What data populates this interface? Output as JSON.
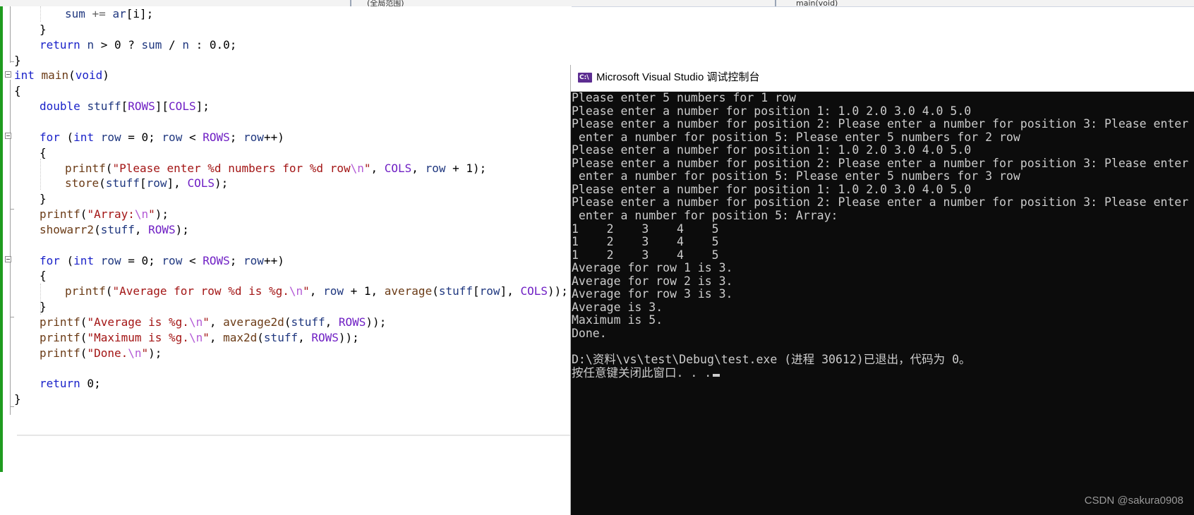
{
  "tabs": {
    "scope": "(全局范围)",
    "member": "main(void)"
  },
  "editor": {
    "lines": [
      {
        "parts": [
          [
            "id",
            "sum"
          ],
          [
            "op",
            " += "
          ],
          [
            "id",
            "ar"
          ],
          [
            "num",
            "[i];"
          ]
        ]
      },
      {
        "parts": [
          [
            "num",
            "}"
          ]
        ]
      },
      {
        "parts": [
          [
            "kw",
            "return"
          ],
          [
            "num",
            " "
          ],
          [
            "id",
            "n"
          ],
          [
            "num",
            " > 0 ? "
          ],
          [
            "id",
            "sum"
          ],
          [
            "num",
            " / "
          ],
          [
            "id",
            "n"
          ],
          [
            "num",
            " : 0.0;"
          ]
        ]
      },
      {
        "parts": [
          [
            "num",
            "}"
          ]
        ]
      },
      {
        "parts": [
          [
            "kw",
            "int"
          ],
          [
            "num",
            " "
          ],
          [
            "fn",
            "main"
          ],
          [
            "num",
            "("
          ],
          [
            "kw",
            "void"
          ],
          [
            "num",
            ")"
          ]
        ]
      },
      {
        "parts": [
          [
            "num",
            "{"
          ]
        ]
      },
      {
        "parts": [
          [
            "kw",
            "double"
          ],
          [
            "num",
            " "
          ],
          [
            "id",
            "stuff"
          ],
          [
            "num",
            "["
          ],
          [
            "mac",
            "ROWS"
          ],
          [
            "num",
            "]["
          ],
          [
            "mac",
            "COLS"
          ],
          [
            "num",
            "];"
          ]
        ]
      },
      {
        "parts": []
      },
      {
        "parts": [
          [
            "kw",
            "for"
          ],
          [
            "num",
            " ("
          ],
          [
            "kw",
            "int"
          ],
          [
            "num",
            " "
          ],
          [
            "id",
            "row"
          ],
          [
            "num",
            " = 0; "
          ],
          [
            "id",
            "row"
          ],
          [
            "num",
            " < "
          ],
          [
            "mac",
            "ROWS"
          ],
          [
            "num",
            "; "
          ],
          [
            "id",
            "row"
          ],
          [
            "num",
            "++)"
          ]
        ]
      },
      {
        "parts": [
          [
            "num",
            "{"
          ]
        ]
      },
      {
        "parts": [
          [
            "fn",
            "printf"
          ],
          [
            "num",
            "("
          ],
          [
            "str",
            "\"Please enter %d numbers for %d row"
          ],
          [
            "esc",
            "\\n"
          ],
          [
            "str",
            "\""
          ],
          [
            "num",
            ", "
          ],
          [
            "mac",
            "COLS"
          ],
          [
            "num",
            ", "
          ],
          [
            "id",
            "row"
          ],
          [
            "num",
            " + 1);"
          ]
        ]
      },
      {
        "parts": [
          [
            "fn",
            "store"
          ],
          [
            "num",
            "("
          ],
          [
            "id",
            "stuff"
          ],
          [
            "num",
            "["
          ],
          [
            "id",
            "row"
          ],
          [
            "num",
            "], "
          ],
          [
            "mac",
            "COLS"
          ],
          [
            "num",
            ");"
          ]
        ]
      },
      {
        "parts": [
          [
            "num",
            "}"
          ]
        ]
      },
      {
        "parts": [
          [
            "fn",
            "printf"
          ],
          [
            "num",
            "("
          ],
          [
            "str",
            "\"Array:"
          ],
          [
            "esc",
            "\\n"
          ],
          [
            "str",
            "\""
          ],
          [
            "num",
            ");"
          ]
        ]
      },
      {
        "parts": [
          [
            "fn",
            "showarr2"
          ],
          [
            "num",
            "("
          ],
          [
            "id",
            "stuff"
          ],
          [
            "num",
            ", "
          ],
          [
            "mac",
            "ROWS"
          ],
          [
            "num",
            ");"
          ]
        ]
      },
      {
        "parts": []
      },
      {
        "parts": [
          [
            "kw",
            "for"
          ],
          [
            "num",
            " ("
          ],
          [
            "kw",
            "int"
          ],
          [
            "num",
            " "
          ],
          [
            "id",
            "row"
          ],
          [
            "num",
            " = 0; "
          ],
          [
            "id",
            "row"
          ],
          [
            "num",
            " < "
          ],
          [
            "mac",
            "ROWS"
          ],
          [
            "num",
            "; "
          ],
          [
            "id",
            "row"
          ],
          [
            "num",
            "++)"
          ]
        ]
      },
      {
        "parts": [
          [
            "num",
            "{"
          ]
        ]
      },
      {
        "parts": [
          [
            "fn",
            "printf"
          ],
          [
            "num",
            "("
          ],
          [
            "str",
            "\"Average for row %d is %g."
          ],
          [
            "esc",
            "\\n"
          ],
          [
            "str",
            "\""
          ],
          [
            "num",
            ", "
          ],
          [
            "id",
            "row"
          ],
          [
            "num",
            " + 1, "
          ],
          [
            "fn",
            "average"
          ],
          [
            "num",
            "("
          ],
          [
            "id",
            "stuff"
          ],
          [
            "num",
            "["
          ],
          [
            "id",
            "row"
          ],
          [
            "num",
            "], "
          ],
          [
            "mac",
            "COLS"
          ],
          [
            "num",
            "));"
          ]
        ]
      },
      {
        "parts": [
          [
            "num",
            "}"
          ]
        ]
      },
      {
        "parts": [
          [
            "fn",
            "printf"
          ],
          [
            "num",
            "("
          ],
          [
            "str",
            "\"Average is %g."
          ],
          [
            "esc",
            "\\n"
          ],
          [
            "str",
            "\""
          ],
          [
            "num",
            ", "
          ],
          [
            "fn",
            "average2d"
          ],
          [
            "num",
            "("
          ],
          [
            "id",
            "stuff"
          ],
          [
            "num",
            ", "
          ],
          [
            "mac",
            "ROWS"
          ],
          [
            "num",
            "));"
          ]
        ]
      },
      {
        "parts": [
          [
            "fn",
            "printf"
          ],
          [
            "num",
            "("
          ],
          [
            "str",
            "\"Maximum is %g."
          ],
          [
            "esc",
            "\\n"
          ],
          [
            "str",
            "\""
          ],
          [
            "num",
            ", "
          ],
          [
            "fn",
            "max2d"
          ],
          [
            "num",
            "("
          ],
          [
            "id",
            "stuff"
          ],
          [
            "num",
            ", "
          ],
          [
            "mac",
            "ROWS"
          ],
          [
            "num",
            "));"
          ]
        ]
      },
      {
        "parts": [
          [
            "fn",
            "printf"
          ],
          [
            "num",
            "("
          ],
          [
            "str",
            "\"Done."
          ],
          [
            "esc",
            "\\n"
          ],
          [
            "str",
            "\""
          ],
          [
            "num",
            ");"
          ]
        ]
      },
      {
        "parts": []
      },
      {
        "parts": [
          [
            "kw",
            "return"
          ],
          [
            "num",
            " 0;"
          ]
        ]
      },
      {
        "parts": [
          [
            "num",
            "}"
          ]
        ]
      }
    ]
  },
  "console": {
    "title": "Microsoft Visual Studio 调试控制台",
    "icon": "vs-console-icon",
    "lines": [
      "Please enter 5 numbers for 1 row",
      "Please enter a number for position 1: 1.0 2.0 3.0 4.0 5.0",
      "Please enter a number for position 2: Please enter a number for position 3: Please enter",
      " enter a number for position 5: Please enter 5 numbers for 2 row",
      "Please enter a number for position 1: 1.0 2.0 3.0 4.0 5.0",
      "Please enter a number for position 2: Please enter a number for position 3: Please enter",
      " enter a number for position 5: Please enter 5 numbers for 3 row",
      "Please enter a number for position 1: 1.0 2.0 3.0 4.0 5.0",
      "Please enter a number for position 2: Please enter a number for position 3: Please enter",
      " enter a number for position 5: Array:",
      "1    2    3    4    5",
      "1    2    3    4    5",
      "1    2    3    4    5",
      "Average for row 1 is 3.",
      "Average for row 2 is 3.",
      "Average for row 3 is 3.",
      "Average is 3.",
      "Maximum is 5.",
      "Done.",
      "",
      "D:\\资料\\vs\\test\\Debug\\test.exe (进程 30612)已退出，代码为 0。",
      "按任意键关闭此窗口. . ."
    ]
  },
  "watermark": "CSDN @sakura0908"
}
